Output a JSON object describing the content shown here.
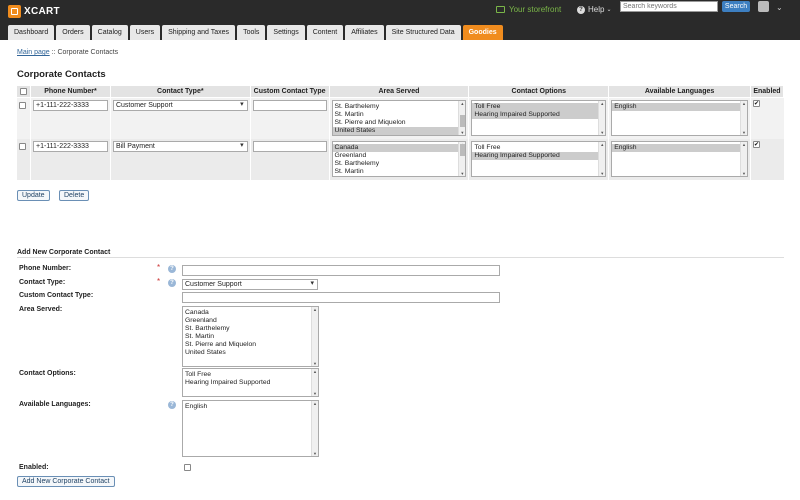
{
  "app": {
    "logo_text": "XCART"
  },
  "header": {
    "storefront_label": "Your storefront",
    "help_label": "Help",
    "search_placeholder": "Search keywords",
    "search_button": "Search"
  },
  "nav": {
    "tabs": [
      "Dashboard",
      "Orders",
      "Catalog",
      "Users",
      "Shipping and Taxes",
      "Tools",
      "Settings",
      "Content",
      "Affiliates",
      "Site Structured Data",
      "Goodies"
    ],
    "active_index": 10
  },
  "breadcrumb": {
    "home": "Main page",
    "separator": " :: ",
    "current": "Corporate Contacts"
  },
  "page": {
    "title": "Corporate Contacts"
  },
  "table": {
    "headers": {
      "phone": "Phone Number*",
      "type": "Contact Type*",
      "custom": "Custom Contact Type",
      "area": "Area Served",
      "options": "Contact Options",
      "languages": "Available Languages",
      "enabled": "Enabled"
    },
    "rows": [
      {
        "phone": "+1-111-222-3333",
        "type": "Customer Support",
        "custom": "",
        "area": [
          {
            "label": "St. Barthelemy",
            "selected": false
          },
          {
            "label": "St. Martin",
            "selected": false
          },
          {
            "label": "St. Pierre and Miquelon",
            "selected": false
          },
          {
            "label": "United States",
            "selected": true
          }
        ],
        "options": [
          {
            "label": "Toll Free",
            "selected": true
          },
          {
            "label": "Hearing Impaired Supported",
            "selected": true
          }
        ],
        "languages": [
          {
            "label": "English",
            "selected": true
          }
        ],
        "enabled": true
      },
      {
        "phone": "+1-111-222-3333",
        "type": "Bill Payment",
        "custom": "",
        "area": [
          {
            "label": "Canada",
            "selected": true
          },
          {
            "label": "Greenland",
            "selected": false
          },
          {
            "label": "St. Barthelemy",
            "selected": false
          },
          {
            "label": "St. Martin",
            "selected": false
          }
        ],
        "options": [
          {
            "label": "Toll Free",
            "selected": false
          },
          {
            "label": "Hearing Impaired Supported",
            "selected": true
          }
        ],
        "languages": [
          {
            "label": "English",
            "selected": true
          }
        ],
        "enabled": true
      }
    ]
  },
  "actions": {
    "update": "Update",
    "delete": "Delete"
  },
  "add_form": {
    "title": "Add New Corporate Contact",
    "phone_label": "Phone Number:",
    "type_label": "Contact Type:",
    "type_value": "Customer Support",
    "custom_label": "Custom Contact Type:",
    "area_label": "Area Served:",
    "area_options": [
      "Canada",
      "Greenland",
      "St. Barthelemy",
      "St. Martin",
      "St. Pierre and Miquelon",
      "United States"
    ],
    "options_label": "Contact Options:",
    "options_list": [
      "Toll Free",
      "Hearing Impaired Supported"
    ],
    "languages_label": "Available Languages:",
    "languages_list": [
      "English"
    ],
    "enabled_label": "Enabled:",
    "submit": "Add New Corporate Contact",
    "required_mark": "*",
    "hint_mark": "?"
  }
}
